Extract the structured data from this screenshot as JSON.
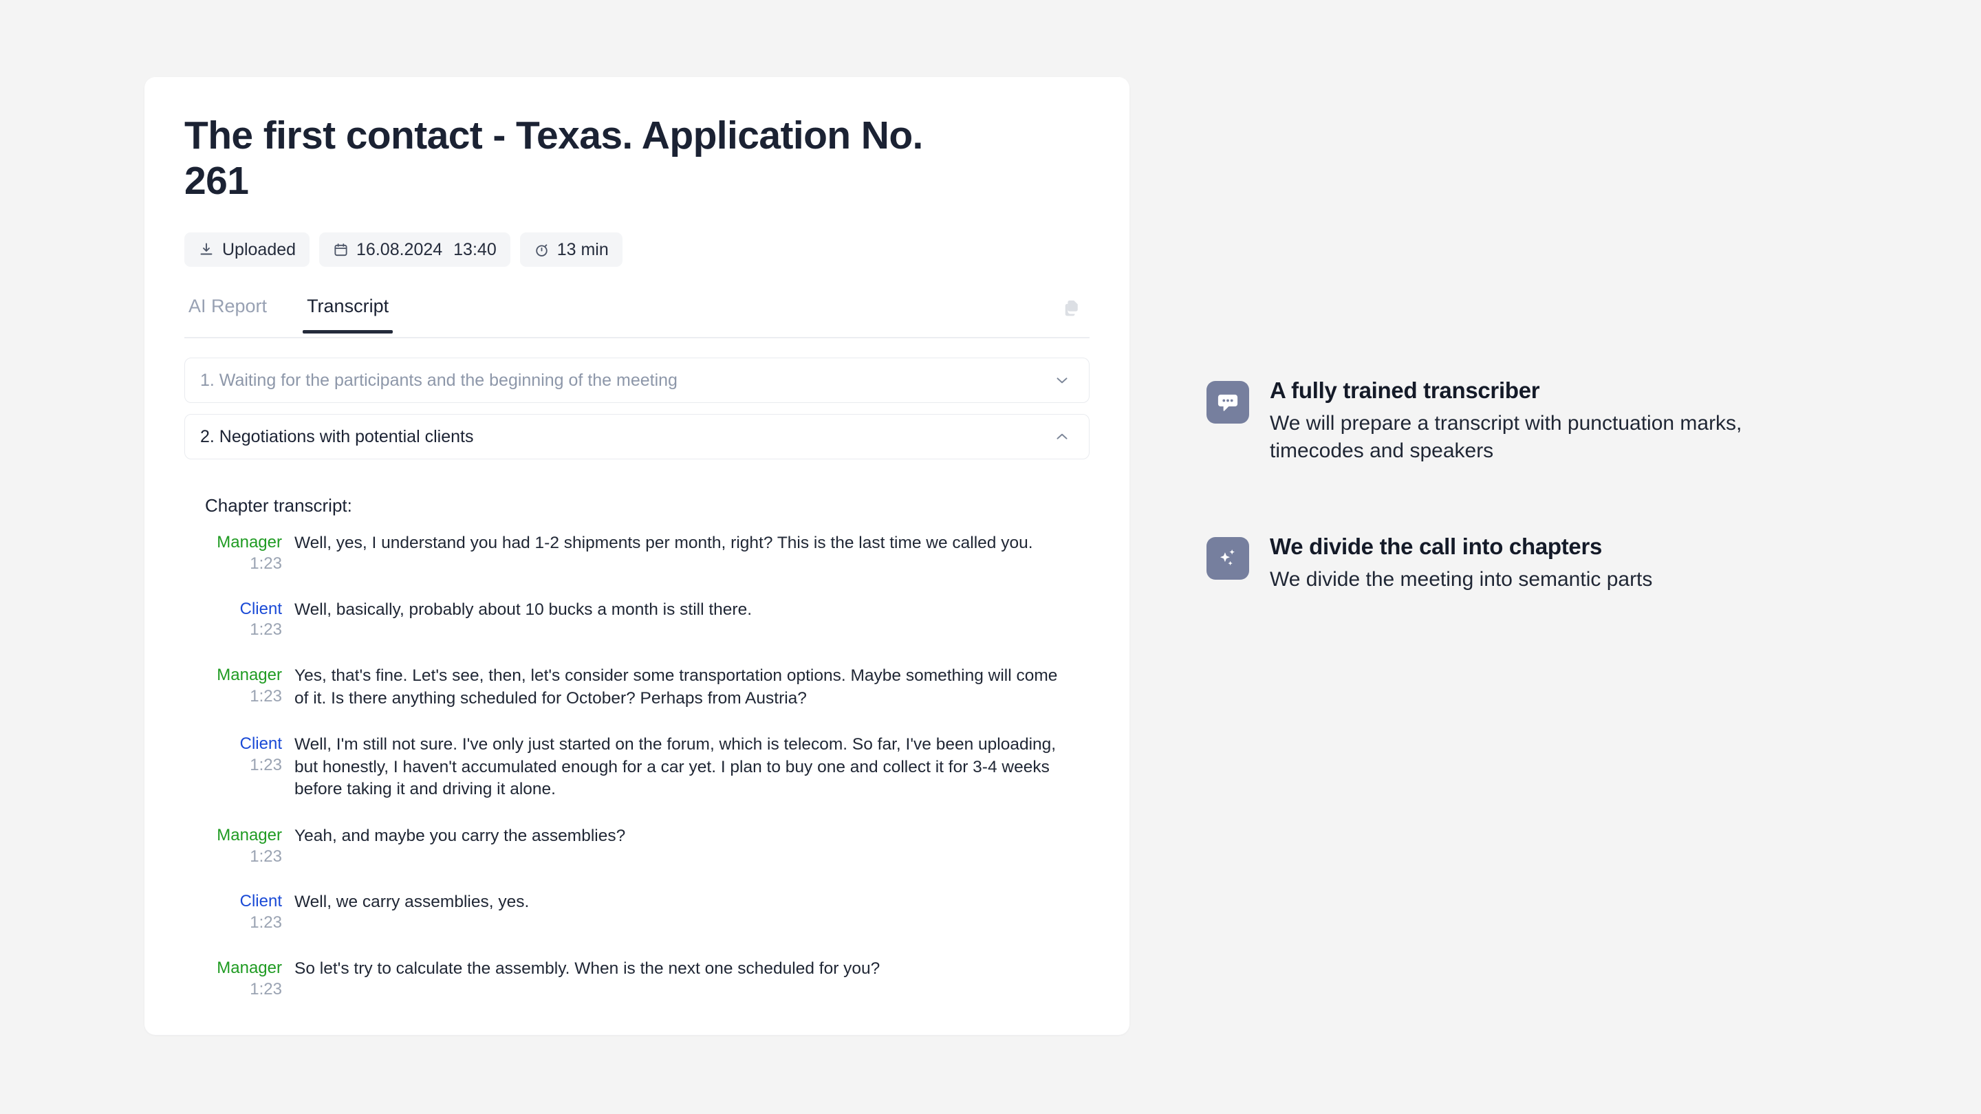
{
  "card": {
    "title": "The first contact - Texas. Application No. 261",
    "badges": [
      {
        "icon": "download-icon",
        "label": "Uploaded"
      },
      {
        "icon": "calendar-icon",
        "date": "16.08.2024",
        "time": "13:40"
      },
      {
        "icon": "stopwatch-icon",
        "label": "13 min"
      }
    ],
    "tabs": [
      {
        "label": "AI Report",
        "active": false
      },
      {
        "label": "Transcript",
        "active": true
      }
    ],
    "copy_icon": "copy-icon",
    "accordions": [
      {
        "label": "1. Waiting for the participants and the beginning of the meeting",
        "open": false,
        "icon": "chevron-down-icon"
      },
      {
        "label": "2. Negotiations with potential clients",
        "open": true,
        "icon": "chevron-up-icon"
      }
    ],
    "chapter_transcript_label": "Chapter transcript:",
    "lines": [
      {
        "speaker": "Manager",
        "role": "manager",
        "time": "1:23",
        "text": "Well, yes, I understand you had 1-2 shipments per month, right? This is the last time we called you."
      },
      {
        "speaker": "Client",
        "role": "client",
        "time": "1:23",
        "text": "Well, basically, probably about 10 bucks a month is still there."
      },
      {
        "speaker": "Manager",
        "role": "manager",
        "time": "1:23",
        "text": "Yes, that's fine. Let's see, then, let's consider some transportation options. Maybe something will come of it. Is there anything scheduled for October? Perhaps from Austria?"
      },
      {
        "speaker": "Client",
        "role": "client",
        "time": "1:23",
        "text": "Well, I'm still not sure. I've only just started on the forum, which is telecom. So far, I've been uploading, but honestly, I haven't accumulated enough for a car yet. I plan to buy one and collect it for 3-4 weeks before taking it and driving it alone."
      },
      {
        "speaker": "Manager",
        "role": "manager",
        "time": "1:23",
        "text": "Yeah, and maybe you carry the assemblies?"
      },
      {
        "speaker": "Client",
        "role": "client",
        "time": "1:23",
        "text": "Well, we carry assemblies, yes."
      },
      {
        "speaker": "Manager",
        "role": "manager",
        "time": "1:23",
        "text": "So let's try to calculate the assembly. When is the next one scheduled for you?"
      }
    ]
  },
  "features": [
    {
      "icon": "chat-bubble-icon",
      "title": "A fully trained transcriber",
      "desc": "We will prepare a transcript with punctuation marks, timecodes and speakers"
    },
    {
      "icon": "sparkles-icon",
      "title": "We divide the call into chapters",
      "desc": "We divide the meeting into semantic parts"
    }
  ],
  "colors": {
    "page_background": "#f4f4f4",
    "card_background": "#ffffff",
    "text_primary": "#1b2233",
    "text_muted": "#98a1b3",
    "manager_green": "#1f9b22",
    "client_blue": "#1a4ad6",
    "feature_icon_bg": "#767f9e",
    "tab_underline": "#242b3b"
  }
}
